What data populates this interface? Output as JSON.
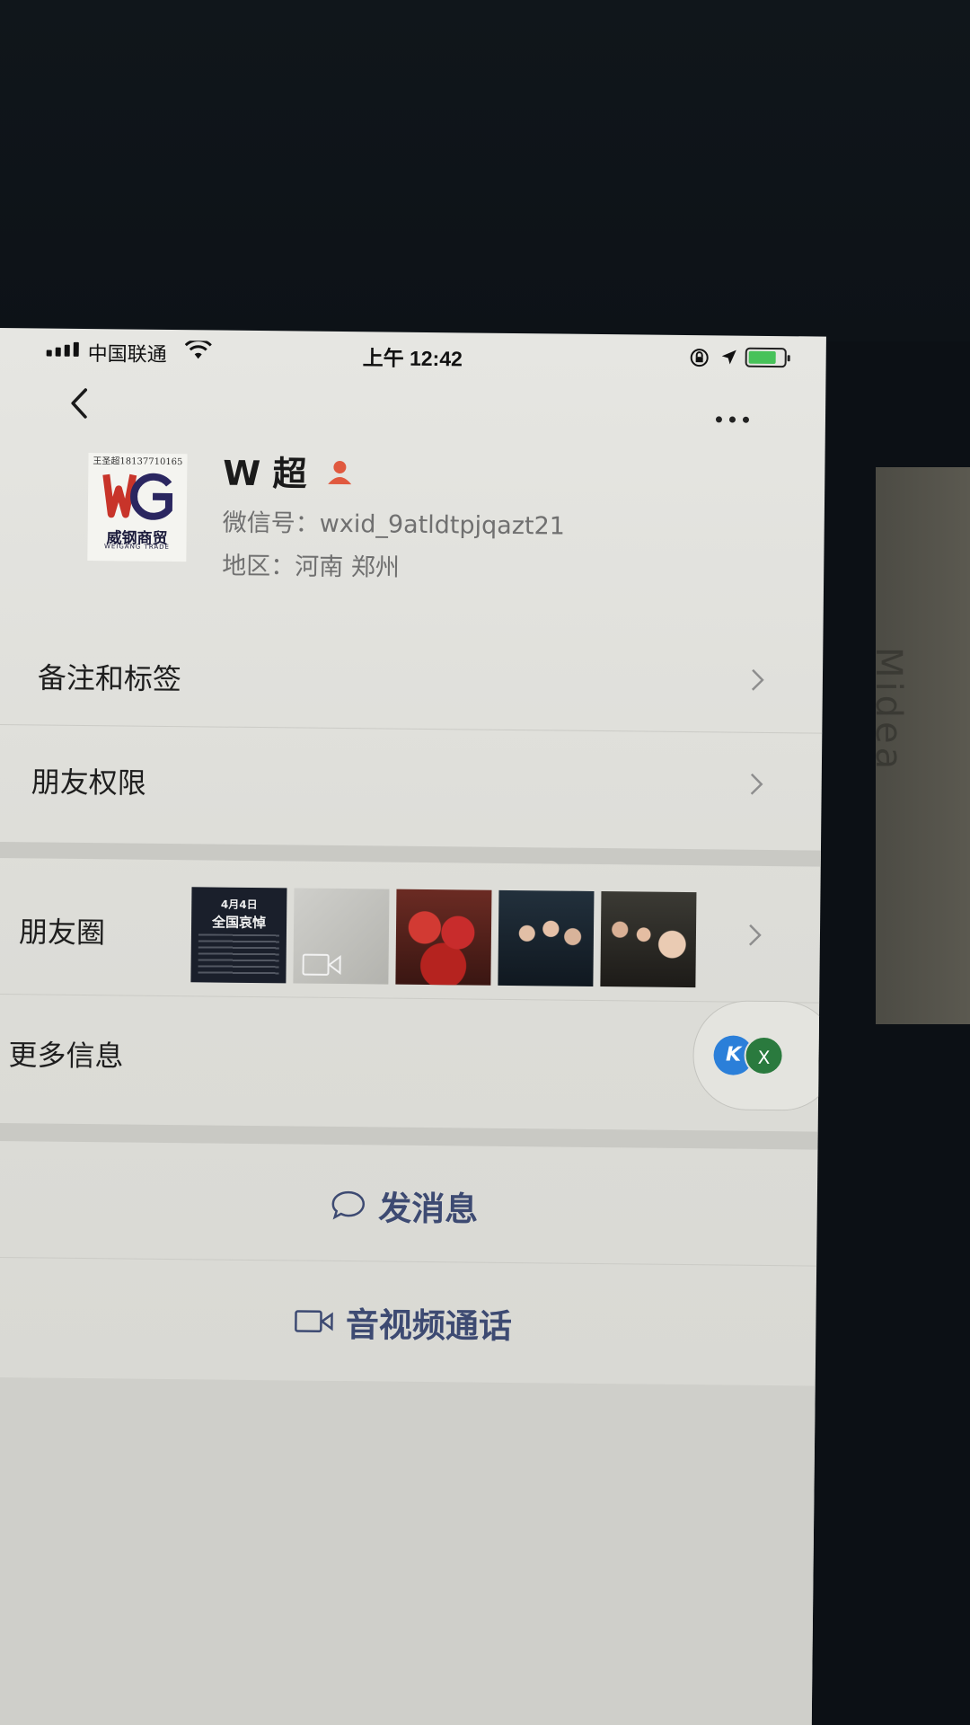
{
  "status_bar": {
    "carrier": "中国联通",
    "time": "上午 12:42",
    "battery_level": 0.8,
    "battery_color": "#47c259"
  },
  "nav": {
    "back_icon": "chevron-left-icon",
    "more_icon": "more-dots-icon"
  },
  "profile": {
    "avatar_caption": "王圣超18137710165",
    "avatar_brand": "威钢商贸",
    "avatar_brand_en": "WEIGANG TRADE",
    "name": "W 超",
    "wechat_id": "微信号：wxid_9atldtpjqazt21",
    "region": "地区：河南 郑州",
    "gender_icon_color": "#e0593f"
  },
  "rows": {
    "remarks": "备注和标签",
    "permissions": "朋友权限",
    "moments": "朋友圈",
    "more_info": "更多信息"
  },
  "moments": {
    "memorial_date": "4月4日",
    "memorial_title": "全国哀悼"
  },
  "floating_widget": {
    "k_label": "K",
    "x_label": "X"
  },
  "actions": {
    "send_message": "发消息",
    "av_call": "音视频通话",
    "accent_color": "#3d4a72"
  },
  "background": {
    "side_label": "Midea"
  }
}
